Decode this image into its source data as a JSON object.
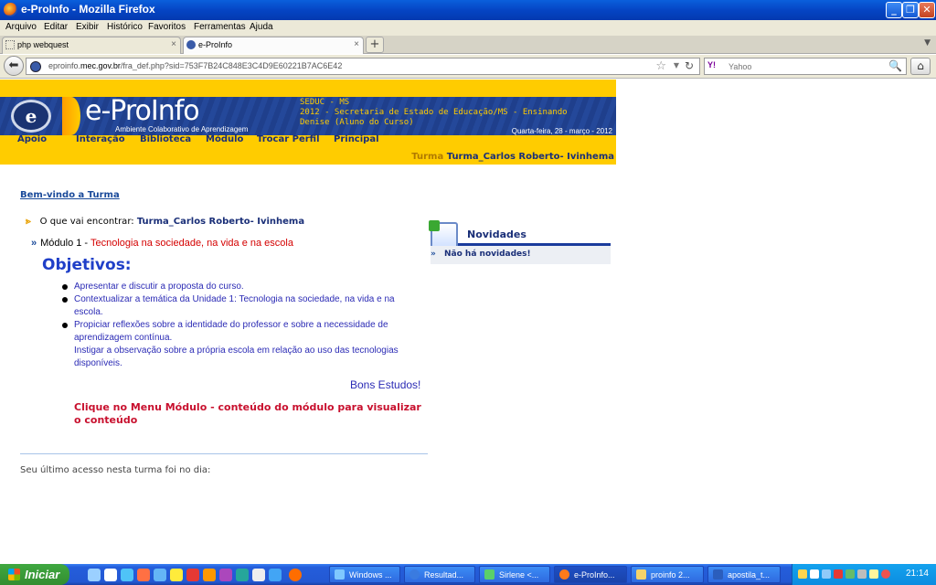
{
  "window": {
    "title": "e-ProInfo - Mozilla Firefox"
  },
  "menubar": [
    "Arquivo",
    "Editar",
    "Exibir",
    "Histórico",
    "Favoritos",
    "Ferramentas",
    "Ajuda"
  ],
  "tabs": [
    {
      "label": "php webquest",
      "active": false
    },
    {
      "label": "e-ProInfo",
      "active": true
    }
  ],
  "nav": {
    "url_prefix": "eproinfo.",
    "url_domain": "mec.gov.br",
    "url_path": "/fra_def.php?sid=753F7B24C848E3C4D9E60221B7AC6E42",
    "search_engine": "Y!",
    "search_placeholder": "Yahoo"
  },
  "banner": {
    "brand": "e-ProInfo",
    "tagline": "Ambiente Colaborativo de Aprendizagem",
    "info_line1": "SEDUC - MS",
    "info_line2": "2012 - Secretaria de Estado de Educação/MS - Ensinando",
    "info_line3": "Denise (Aluno do Curso)",
    "date": "Quarta-feira, 28 - março - 2012",
    "menu": [
      "Apoio",
      "Interação",
      "Biblioteca",
      "Módulo",
      "Trocar Perfil",
      "Principal"
    ],
    "turma_label": "Turma",
    "turma_value": "Turma_Carlos Roberto- Ivinhema"
  },
  "content": {
    "welcome": "Bem-vindo a Turma",
    "encontrar_label": "O que vai encontrar:",
    "encontrar_value": "Turma_Carlos Roberto- Ivinhema",
    "modulo_prefix": "Módulo 1 -",
    "modulo_title": "Tecnologia na sociedade, na vida e na escola",
    "objetivos_title": "Objetivos:",
    "objetivos": [
      "Apresentar e discutir a proposta do curso.",
      " Contextualizar a temática da Unidade 1: Tecnologia na sociedade, na vida e na escola.",
      "Propiciar reflexões sobre a identidade do professor e sobre a necessidade de aprendizagem contínua."
    ],
    "objetivo_extra": "Instigar a observação sobre a própria escola em relação ao uso das tecnologias disponíveis.",
    "bons_estudos": "Bons Estudos!",
    "clique": "Clique no Menu Módulo - conteúdo do módulo para visualizar o conteúdo",
    "ultimo_acesso": "Seu último acesso nesta turma foi no dia:"
  },
  "novidades": {
    "title": "Novidades",
    "empty": "Não há novidades!"
  },
  "taskbar": {
    "start": "Iniciar",
    "tasks": [
      "Windows ...",
      "Resultad...",
      "Sirlene <...",
      "e-ProInfo...",
      "proinfo 2...",
      "apostila_t..."
    ],
    "clock": "21:14"
  }
}
